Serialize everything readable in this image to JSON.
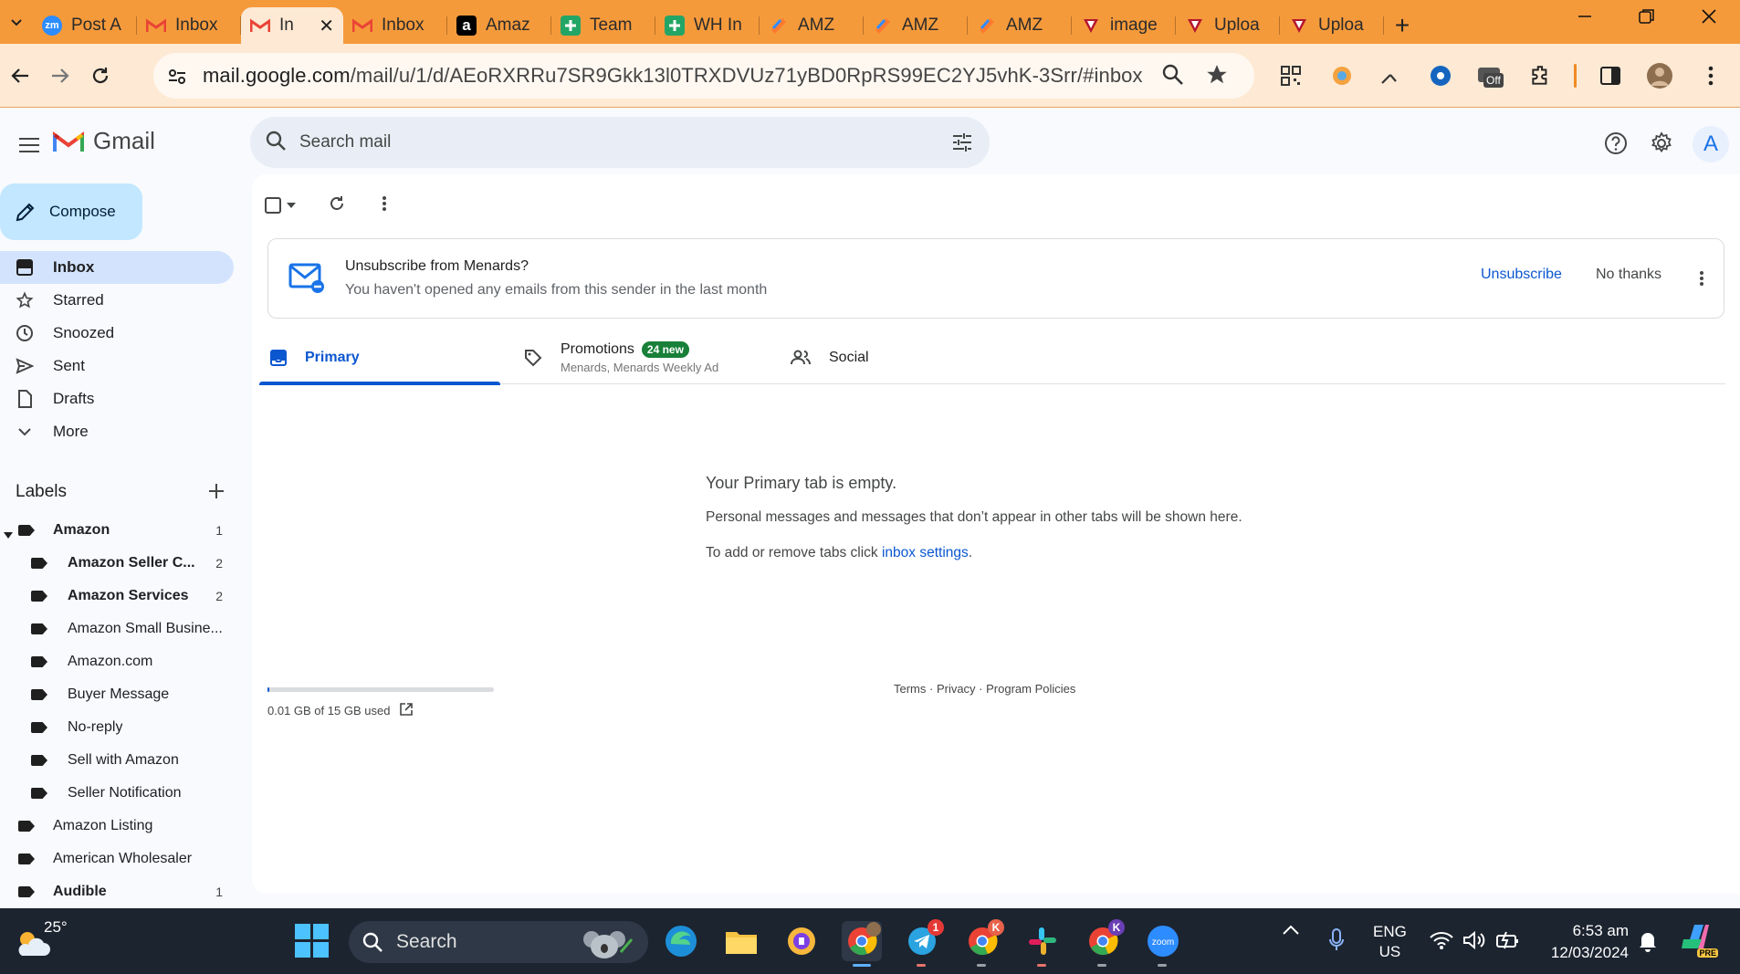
{
  "browser": {
    "tabs": [
      {
        "title": "Post A",
        "favicon": "zoom-icon",
        "color": "#2d8cff"
      },
      {
        "title": "Inbox",
        "favicon": "gmail-icon",
        "color": "#ea4335"
      },
      {
        "title": "In",
        "favicon": "gmail-icon",
        "color": "#ea4335",
        "active": true
      },
      {
        "title": "Inbox",
        "favicon": "gmail-icon",
        "color": "#ea4335"
      },
      {
        "title": "Amaz",
        "favicon": "amazon-icon",
        "color": "#000000"
      },
      {
        "title": "Team",
        "favicon": "sheets-icon",
        "color": "#23a566"
      },
      {
        "title": "WH In",
        "favicon": "sheets-icon",
        "color": "#23a566"
      },
      {
        "title": "AMZ",
        "favicon": "clickup-icon",
        "color": "#7b68ee"
      },
      {
        "title": "AMZ",
        "favicon": "clickup-icon",
        "color": "#7b68ee"
      },
      {
        "title": "AMZ",
        "favicon": "clickup-icon",
        "color": "#7b68ee"
      },
      {
        "title": "image",
        "favicon": "shield-red-icon",
        "color": "#c2185b"
      },
      {
        "title": "Uploa",
        "favicon": "shield-red-icon",
        "color": "#c2185b"
      },
      {
        "title": "Uploa",
        "favicon": "shield-red-icon",
        "color": "#c2185b"
      }
    ],
    "url_host": "mail.google.com",
    "url_path": "/mail/u/1/d/AEoRXRRu7SR9Gkk13l0TRXDVUz71yBD0RpRS99EC2YJ5vhK-3Srr/#inbox",
    "extension_badge": "Off",
    "accent": "#f59a3b"
  },
  "gmail": {
    "app_name": "Gmail",
    "search_placeholder": "Search mail",
    "avatar_letter": "A",
    "compose_label": "Compose",
    "nav": [
      {
        "label": "Inbox",
        "icon": "inbox-icon",
        "active": true
      },
      {
        "label": "Starred",
        "icon": "star-icon"
      },
      {
        "label": "Snoozed",
        "icon": "clock-icon"
      },
      {
        "label": "Sent",
        "icon": "send-icon"
      },
      {
        "label": "Drafts",
        "icon": "draft-icon"
      },
      {
        "label": "More",
        "icon": "chevron-down-icon"
      }
    ],
    "labels_title": "Labels",
    "labels": [
      {
        "name": "Amazon",
        "count": "1",
        "bold": true,
        "level": 0,
        "expanded": true
      },
      {
        "name": "Amazon Seller C...",
        "count": "2",
        "bold": true,
        "level": 1
      },
      {
        "name": "Amazon Services",
        "count": "2",
        "bold": true,
        "level": 1
      },
      {
        "name": "Amazon Small Busine...",
        "count": "",
        "bold": false,
        "level": 1
      },
      {
        "name": "Amazon.com",
        "count": "",
        "bold": false,
        "level": 1
      },
      {
        "name": "Buyer Message",
        "count": "",
        "bold": false,
        "level": 1
      },
      {
        "name": "No-reply",
        "count": "",
        "bold": false,
        "level": 1
      },
      {
        "name": "Sell with Amazon",
        "count": "",
        "bold": false,
        "level": 1
      },
      {
        "name": "Seller Notification",
        "count": "",
        "bold": false,
        "level": 1
      },
      {
        "name": "Amazon Listing",
        "count": "",
        "bold": false,
        "level": 0
      },
      {
        "name": "American Wholesaler",
        "count": "",
        "bold": false,
        "level": 0
      },
      {
        "name": "Audible",
        "count": "1",
        "bold": true,
        "level": 0
      }
    ],
    "banner": {
      "title": "Unsubscribe from Menards?",
      "subtitle": "You haven't opened any emails from this sender in the last month",
      "unsubscribe": "Unsubscribe",
      "no_thanks": "No thanks"
    },
    "category_tabs": {
      "primary": "Primary",
      "promotions": "Promotions",
      "promotions_badge": "24 new",
      "promotions_sub": "Menards, Menards Weekly Ad",
      "social": "Social"
    },
    "empty": {
      "title": "Your Primary tab is empty.",
      "subtitle": "Personal messages and messages that don’t appear in other tabs will be shown here.",
      "settings_prefix": "To add or remove tabs click ",
      "settings_link": "inbox settings",
      "settings_suffix": "."
    },
    "storage": {
      "text": "0.01 GB of 15 GB used",
      "fraction": 0.001
    },
    "footer": "Terms · Privacy · Program Policies"
  },
  "taskbar": {
    "temperature": "25°",
    "search_label": "Search",
    "lang_line1": "ENG",
    "lang_line2": "US",
    "time": "6:53 am",
    "date": "12/03/2024",
    "telegram_badge": "1",
    "chrome_profile_k": "K",
    "chrome_profile_k2": "K",
    "copilot_badge": "PRE"
  }
}
